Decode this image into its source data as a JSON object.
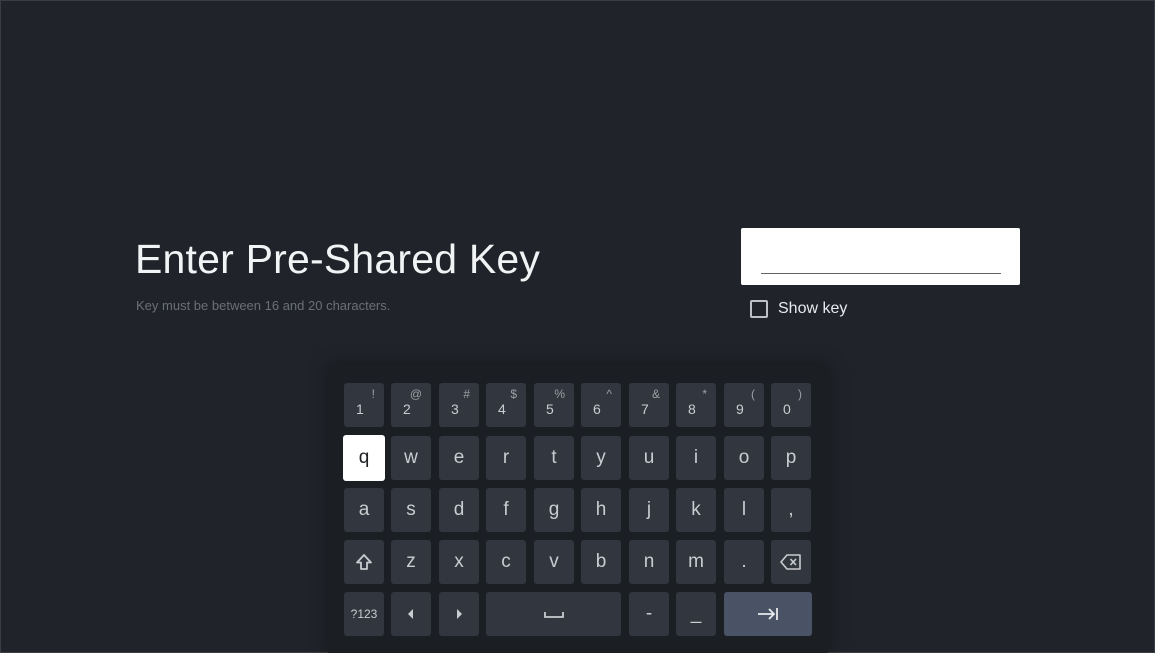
{
  "page": {
    "title": "Enter Pre-Shared Key",
    "subtitle": "Key must be between 16 and 20 characters."
  },
  "key_input": {
    "value": ""
  },
  "show_key": {
    "label": "Show key",
    "checked": false
  },
  "keyboard": {
    "rows": [
      [
        {
          "main": "1",
          "alt": "!"
        },
        {
          "main": "2",
          "alt": "@"
        },
        {
          "main": "3",
          "alt": "#"
        },
        {
          "main": "4",
          "alt": "$"
        },
        {
          "main": "5",
          "alt": "%"
        },
        {
          "main": "6",
          "alt": "^"
        },
        {
          "main": "7",
          "alt": "&"
        },
        {
          "main": "8",
          "alt": "*"
        },
        {
          "main": "9",
          "alt": "("
        },
        {
          "main": "0",
          "alt": ")"
        }
      ],
      [
        {
          "label": "q"
        },
        {
          "label": "w"
        },
        {
          "label": "e"
        },
        {
          "label": "r"
        },
        {
          "label": "t"
        },
        {
          "label": "y"
        },
        {
          "label": "u"
        },
        {
          "label": "i"
        },
        {
          "label": "o"
        },
        {
          "label": "p"
        }
      ],
      [
        {
          "label": "a"
        },
        {
          "label": "s"
        },
        {
          "label": "d"
        },
        {
          "label": "f"
        },
        {
          "label": "g"
        },
        {
          "label": "h"
        },
        {
          "label": "j"
        },
        {
          "label": "k"
        },
        {
          "label": "l"
        },
        {
          "label": ","
        }
      ],
      [
        {
          "icon": "shift-icon"
        },
        {
          "label": "z"
        },
        {
          "label": "x"
        },
        {
          "label": "c"
        },
        {
          "label": "v"
        },
        {
          "label": "b"
        },
        {
          "label": "n"
        },
        {
          "label": "m"
        },
        {
          "label": "."
        },
        {
          "icon": "backspace-icon"
        }
      ],
      [
        {
          "label": "?123"
        },
        {
          "icon": "cursor-left-icon"
        },
        {
          "icon": "cursor-right-icon"
        },
        {
          "icon": "space-icon"
        },
        {
          "label": "-"
        },
        {
          "label": "_"
        },
        {
          "icon": "tab-next-icon"
        }
      ]
    ],
    "selected_key": "q"
  },
  "colors": {
    "background": "#202329",
    "key": "#32363e",
    "key_action": "#495365",
    "selected_key": "#ffffff"
  }
}
